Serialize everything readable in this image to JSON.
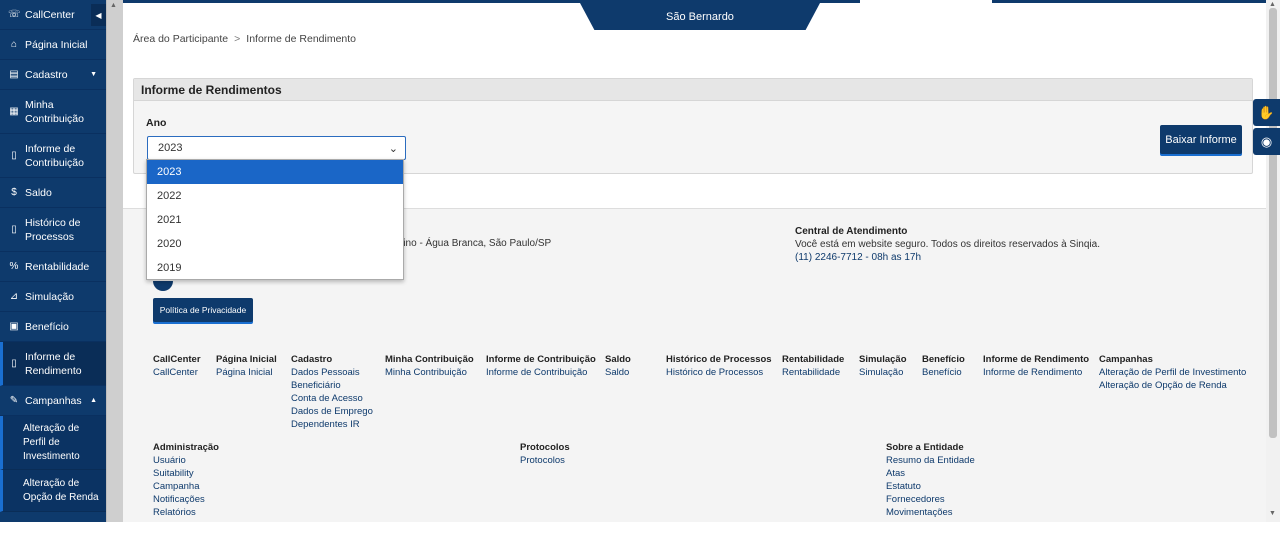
{
  "sidebar": {
    "toggle_icon": "chevron-left-icon",
    "items": [
      {
        "label": "CallCenter",
        "icon": "headset-icon",
        "glyph": "☏"
      },
      {
        "label": "Página Inicial",
        "icon": "home-icon",
        "glyph": "⌂"
      },
      {
        "label": "Cadastro",
        "icon": "id-card-icon",
        "glyph": "▤"
      },
      {
        "label": "Minha Contribuição",
        "icon": "calculator-icon",
        "glyph": "▦"
      },
      {
        "label": "Informe de Contribuição",
        "icon": "document-icon",
        "glyph": "▯"
      },
      {
        "label": "Saldo",
        "icon": "dollar-icon",
        "glyph": "$"
      },
      {
        "label": "Histórico de Processos",
        "icon": "document-icon",
        "glyph": "▯"
      },
      {
        "label": "Rentabilidade",
        "icon": "percent-icon",
        "glyph": "%"
      },
      {
        "label": "Simulação",
        "icon": "chart-icon",
        "glyph": "⊿"
      },
      {
        "label": "Benefício",
        "icon": "clipboard-icon",
        "glyph": "▣"
      },
      {
        "label": "Informe de Rendimento",
        "icon": "document-icon",
        "glyph": "▯"
      },
      {
        "label": "Campanhas",
        "icon": "edit-icon",
        "glyph": "✎"
      }
    ],
    "sub_items": [
      {
        "label": "Alteração de Perfil de Investimento"
      },
      {
        "label": "Alteração de Opção de Renda"
      }
    ]
  },
  "header": {
    "entity_tab": "São Bernardo"
  },
  "breadcrumb": {
    "root": "Área do Participante",
    "separator": ">",
    "current": "Informe de Rendimento"
  },
  "panel": {
    "title": "Informe de Rendimentos",
    "year_label": "Ano",
    "selected_year": "2023",
    "year_options": [
      "2023",
      "2022",
      "2021",
      "2020",
      "2019"
    ],
    "download_button": "Baixar Informe"
  },
  "footer": {
    "address_fragment": "rino - Água Branca, São Paulo/SP",
    "central": {
      "title": "Central de Atendimento",
      "description": "Você está em website seguro. Todos os direitos reservados à Sinqia.",
      "phone": "(11) 2246-7712 - 08h as 17h"
    },
    "privacy_button": "Política de Privacidade",
    "nav_columns": [
      {
        "heading": "CallCenter",
        "links": [
          "CallCenter"
        ]
      },
      {
        "heading": "Página Inicial",
        "links": [
          "Página Inicial"
        ]
      },
      {
        "heading": "Cadastro",
        "links": [
          "Dados Pessoais",
          "Beneficiário",
          "Conta de Acesso",
          "Dados de Emprego",
          "Dependentes IR"
        ]
      },
      {
        "heading": "Minha Contribuição",
        "links": [
          "Minha Contribuição"
        ]
      },
      {
        "heading": "Informe de Contribuição",
        "links": [
          "Informe de Contribuição"
        ]
      },
      {
        "heading": "Saldo",
        "links": [
          "Saldo"
        ]
      },
      {
        "heading": "Histórico de Processos",
        "links": [
          "Histórico de Processos"
        ]
      },
      {
        "heading": "Rentabilidade",
        "links": [
          "Rentabilidade"
        ]
      },
      {
        "heading": "Simulação",
        "links": [
          "Simulação"
        ]
      },
      {
        "heading": "Benefício",
        "links": [
          "Benefício"
        ]
      },
      {
        "heading": "Informe de Rendimento",
        "links": [
          "Informe de Rendimento"
        ]
      },
      {
        "heading": "Campanhas",
        "links": [
          "Alteração de Perfil de Investimento",
          "Alteração de Opção de Renda"
        ]
      }
    ],
    "nav_columns_2": [
      {
        "heading": "Administração",
        "links": [
          "Usuário",
          "Suitability",
          "Campanha",
          "Notificações",
          "Relatórios"
        ]
      },
      {
        "heading": "Protocolos",
        "links": [
          "Protocolos"
        ]
      },
      {
        "heading": "Sobre a Entidade",
        "links": [
          "Resumo da Entidade",
          "Atas",
          "Estatuto",
          "Fornecedores",
          "Movimentações"
        ]
      }
    ]
  },
  "accessibility": {
    "sign_language_icon": "sign-language-icon",
    "visibility_icon": "eye-icon"
  },
  "colors": {
    "brand": "#0e3a6c",
    "accent": "#1a66c7"
  }
}
